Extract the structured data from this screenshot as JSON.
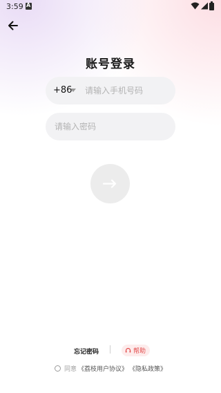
{
  "status_bar": {
    "time": "3:59"
  },
  "header": {
    "back_icon": "arrow-left-icon"
  },
  "title": "账号登录",
  "phone": {
    "country_code": "+86",
    "placeholder": "请输入手机号码"
  },
  "password": {
    "placeholder": "请输入密码"
  },
  "submit": {
    "icon": "arrow-right-icon"
  },
  "footer": {
    "forgot_password": "忘记密码",
    "help": "帮助",
    "agree_prefix": "同意",
    "user_agreement": "《荔枝用户协议》",
    "privacy_policy": "《隐私政策》"
  },
  "colors": {
    "accent_red": "#e24a4a",
    "input_bg": "#f2f2f4"
  }
}
